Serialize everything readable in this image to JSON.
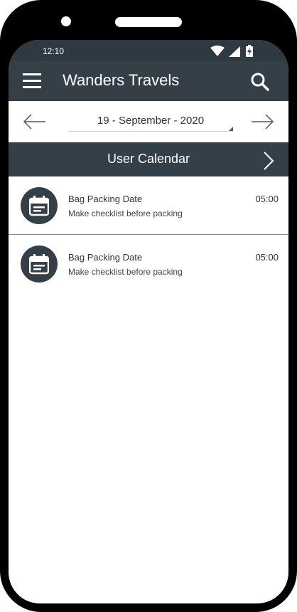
{
  "status_bar": {
    "time": "12:10",
    "icons": [
      "wifi-icon",
      "signal-icon",
      "battery-charging-icon"
    ]
  },
  "app_bar": {
    "title": "Wanders Travels",
    "menu_icon": "hamburger-menu-icon",
    "search_icon": "search-icon"
  },
  "date_nav": {
    "selected_date": "19 - September - 2020",
    "prev_icon": "arrow-left-icon",
    "next_icon": "arrow-right-icon"
  },
  "section": {
    "title": "User Calendar",
    "next_icon": "chevron-right-icon"
  },
  "events": [
    {
      "title": "Bag Packing Date",
      "subtitle": "Make checklist before packing",
      "time": "05:00",
      "icon": "calendar-icon"
    },
    {
      "title": "Bag Packing Date",
      "subtitle": "Make checklist before packing",
      "time": "05:00",
      "icon": "calendar-icon"
    }
  ],
  "colors": {
    "bar": "#353f48",
    "status_bar": "#2f3942",
    "phone_frame": "#000000",
    "background": "#ffffff"
  }
}
